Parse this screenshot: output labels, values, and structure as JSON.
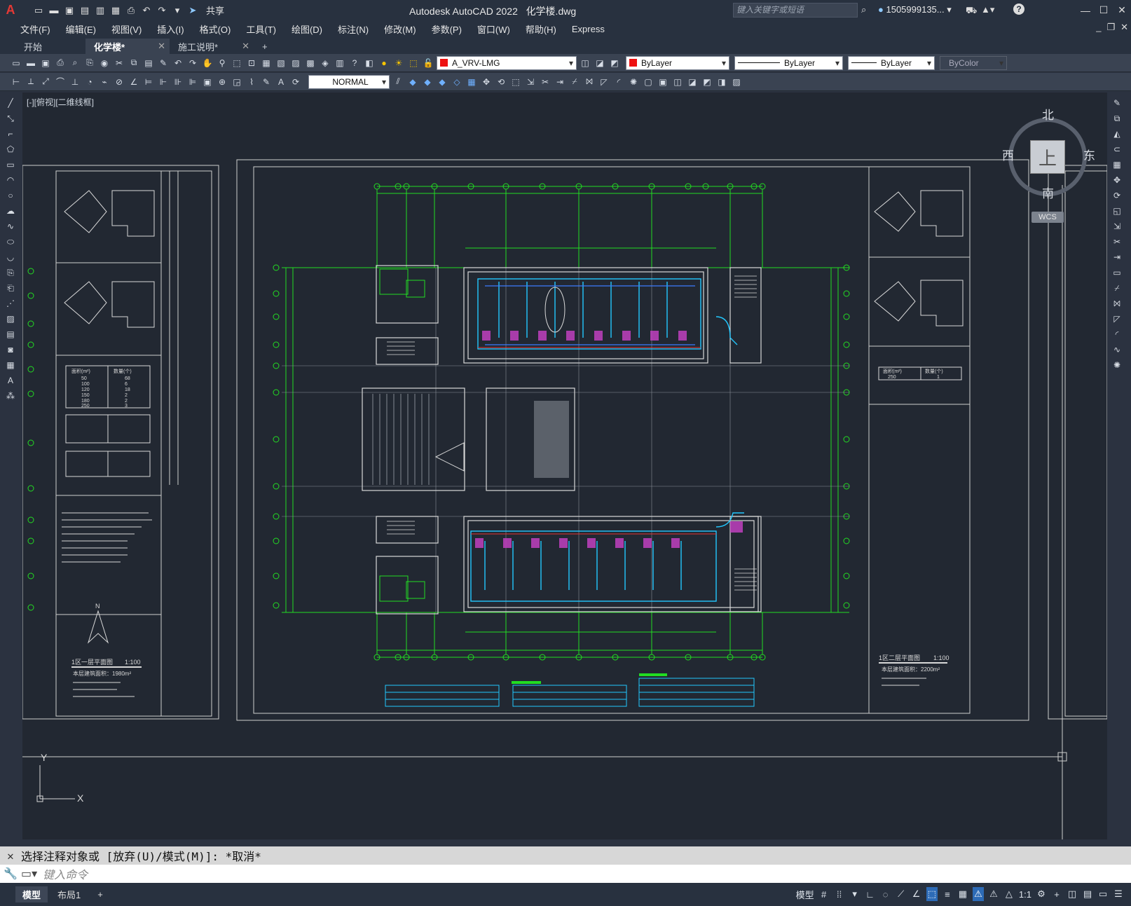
{
  "app": {
    "logo": "A",
    "title": "Autodesk AutoCAD 2022",
    "document": "化学楼.dwg",
    "share_label": "共享",
    "search_placeholder": "键入关键字或短语",
    "user": "1505999135...",
    "help": "?"
  },
  "menu": [
    "文件(F)",
    "编辑(E)",
    "视图(V)",
    "插入(I)",
    "格式(O)",
    "工具(T)",
    "绘图(D)",
    "标注(N)",
    "修改(M)",
    "参数(P)",
    "窗口(W)",
    "帮助(H)",
    "Express"
  ],
  "tabs": [
    {
      "label": "开始",
      "active": false,
      "closable": false
    },
    {
      "label": "化学楼*",
      "active": true,
      "closable": true
    },
    {
      "label": "施工说明*",
      "active": false,
      "closable": true
    }
  ],
  "toolbar": {
    "layer": "A_VRV-LMG",
    "color": "ByLayer",
    "linetype": "ByLayer",
    "lineweight": "ByLayer",
    "plotstyle": "ByColor",
    "dimstyle": "NORMAL"
  },
  "viewport": {
    "label": "[-][俯视][二维线框]"
  },
  "viewcube": {
    "north": "北",
    "south": "南",
    "west": "西",
    "east": "东",
    "face": "上",
    "wcs": "WCS"
  },
  "drawing": {
    "left_title": "1区一层平面图",
    "left_scale": "1:100",
    "right_title": "1区二层平面图",
    "right_scale": "1:100",
    "left_area": "本层建筑面积：1980m²",
    "right_area": "本层建筑面积：2200m²",
    "left_table_header": [
      "面积(m²)",
      "数量(个)"
    ],
    "left_table_rows": [
      [
        "50",
        "68"
      ],
      [
        "100",
        "6"
      ],
      [
        "120",
        "18"
      ],
      [
        "150",
        "2"
      ],
      [
        "180",
        "2"
      ],
      [
        "250",
        "3"
      ]
    ],
    "right_table_header": [
      "面积(m²)",
      "数量(个)"
    ],
    "right_table_rows": [
      [
        "250",
        "1"
      ]
    ],
    "north": "N",
    "ucs_x": "X",
    "ucs_y": "Y"
  },
  "command": {
    "history": "选择注释对象或 [放弃(U)/模式(M)]: *取消*",
    "placeholder": "键入命令"
  },
  "status": {
    "layouts": [
      "模型",
      "布局1"
    ],
    "space": "模型",
    "scale": "1:1"
  },
  "colors": {
    "background": "#222832",
    "chrome": "#28313f",
    "toolbar": "#3a4352",
    "cad_green": "#22dd22",
    "cad_cyan": "#22c8ff",
    "cad_white": "#d8d8d8",
    "cad_magenta": "#e040e0",
    "cad_yellow": "#e6e600",
    "accent_red": "#e53935"
  }
}
